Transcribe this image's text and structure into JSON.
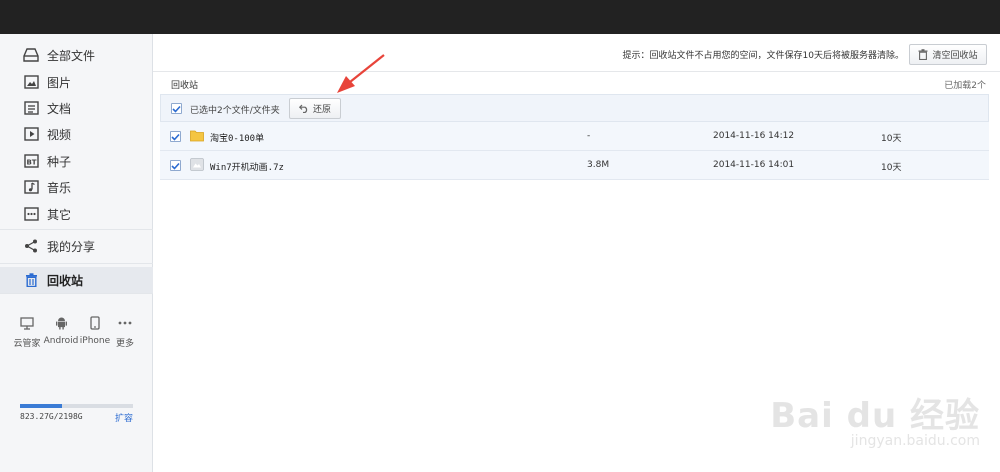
{
  "nav": {
    "all_files": "全部文件",
    "images": "图片",
    "docs": "文档",
    "videos": "视频",
    "torrents": "种子",
    "music": "音乐",
    "others": "其它",
    "my_share": "我的分享",
    "recycle": "回收站"
  },
  "devices": [
    {
      "label": "云管家",
      "icon": "monitor-icon"
    },
    {
      "label": "Android",
      "icon": "android-icon"
    },
    {
      "label": "iPhone",
      "icon": "phone-icon"
    },
    {
      "label": "更多",
      "icon": "more-icon"
    }
  ],
  "quota": {
    "text": "823.27G/2198G",
    "link": "扩容",
    "used_fraction": 0.374
  },
  "tip": {
    "text": "提示：回收站文件不占用您的空间，文件保存10天后将被服务器清除。",
    "empty_button": "清空回收站"
  },
  "breadcrumb": "回收站",
  "loaded": "已加载2个",
  "selection": {
    "text": "已选中2个文件/文件夹",
    "restore_button": "还原"
  },
  "files": [
    {
      "name": "淘宝0-100单",
      "size": "-",
      "date": "2014-11-16 14:12",
      "days": "10天",
      "type": "folder",
      "checked": true
    },
    {
      "name": "Win7开机动画.7z",
      "size": "3.8M",
      "date": "2014-11-16 14:01",
      "days": "10天",
      "type": "archive",
      "checked": true
    }
  ],
  "watermark": {
    "big": "Bai du 经验",
    "small": "jingyan.baidu.com"
  },
  "colors": {
    "accent": "#2b6bd1",
    "arrow": "#e8443a",
    "topbar": "#222222"
  }
}
